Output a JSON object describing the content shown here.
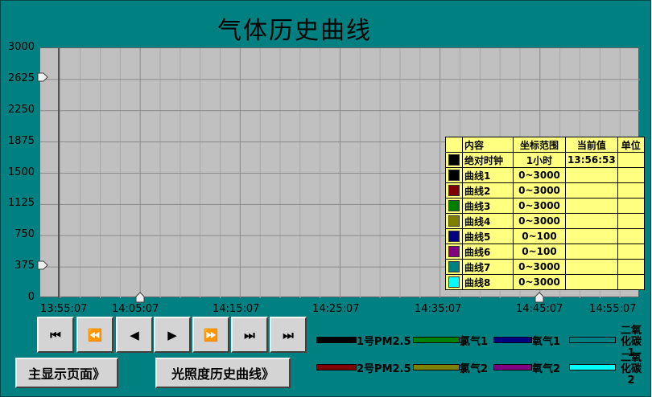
{
  "title": "气体历史曲线",
  "chart_data": {
    "type": "line",
    "title": "气体历史曲线",
    "y_ticks": [
      "3000",
      "2625",
      "2250",
      "1875",
      "1500",
      "1125",
      "750",
      "375",
      "0"
    ],
    "ylim": [
      0,
      3000
    ],
    "x_ticks": [
      "13:55:07",
      "14:05:07",
      "14:15:07",
      "14:25:07",
      "14:35:07",
      "14:45:07",
      "14:55:07"
    ],
    "grid": true,
    "series": []
  },
  "legend_table": {
    "headers": [
      "内容",
      "坐标范围",
      "当前值",
      "单位"
    ],
    "rows": [
      {
        "name": "绝对时钟",
        "range": "1小时",
        "value": "13:56:53",
        "unit": "",
        "color": "#000000"
      },
      {
        "name": "曲线1",
        "range": "0~3000",
        "value": "",
        "unit": "",
        "color": "#000000"
      },
      {
        "name": "曲线2",
        "range": "0~3000",
        "value": "",
        "unit": "",
        "color": "#800000"
      },
      {
        "name": "曲线3",
        "range": "0~3000",
        "value": "",
        "unit": "",
        "color": "#008000"
      },
      {
        "name": "曲线4",
        "range": "0~3000",
        "value": "",
        "unit": "",
        "color": "#808000"
      },
      {
        "name": "曲线5",
        "range": "0~100",
        "value": "",
        "unit": "",
        "color": "#000080"
      },
      {
        "name": "曲线6",
        "range": "0~100",
        "value": "",
        "unit": "",
        "color": "#800080"
      },
      {
        "name": "曲线7",
        "range": "0~3000",
        "value": "",
        "unit": "",
        "color": "#008080"
      },
      {
        "name": "曲线8",
        "range": "0~3000",
        "value": "",
        "unit": "",
        "color": "#00ffff"
      }
    ]
  },
  "nav_buttons": [
    {
      "name": "first-button",
      "icon": "skip-first-icon",
      "glyph": "⏮"
    },
    {
      "name": "fast-back-button",
      "icon": "fast-back-icon",
      "glyph": "⏪"
    },
    {
      "name": "back-button",
      "icon": "step-back-icon",
      "glyph": "◀"
    },
    {
      "name": "forward-button",
      "icon": "step-forward-icon",
      "glyph": "▶"
    },
    {
      "name": "fast-forward-button",
      "icon": "fast-forward-icon",
      "glyph": "⏩"
    },
    {
      "name": "last-button",
      "icon": "skip-last-icon",
      "glyph": "⏭"
    },
    {
      "name": "end-button",
      "icon": "skip-end-icon",
      "glyph": "⏭"
    }
  ],
  "series_legend": {
    "row1": [
      {
        "label": "1号PM2.5",
        "color": "#000000"
      },
      {
        "label": "氯气1",
        "color": "#008000"
      },
      {
        "label": "氧气1",
        "color": "#000080"
      },
      {
        "label": "二氧化碳1",
        "color": "#008080"
      }
    ],
    "row2": [
      {
        "label": "2号PM2.5",
        "color": "#800000"
      },
      {
        "label": "氯气2",
        "color": "#808000"
      },
      {
        "label": "氧气2",
        "color": "#800080"
      },
      {
        "label": "二氧化碳2",
        "color": "#00ffff"
      }
    ]
  },
  "buttons": {
    "main_display": "主显示页面》",
    "light_history": "光照度历史曲线》"
  }
}
